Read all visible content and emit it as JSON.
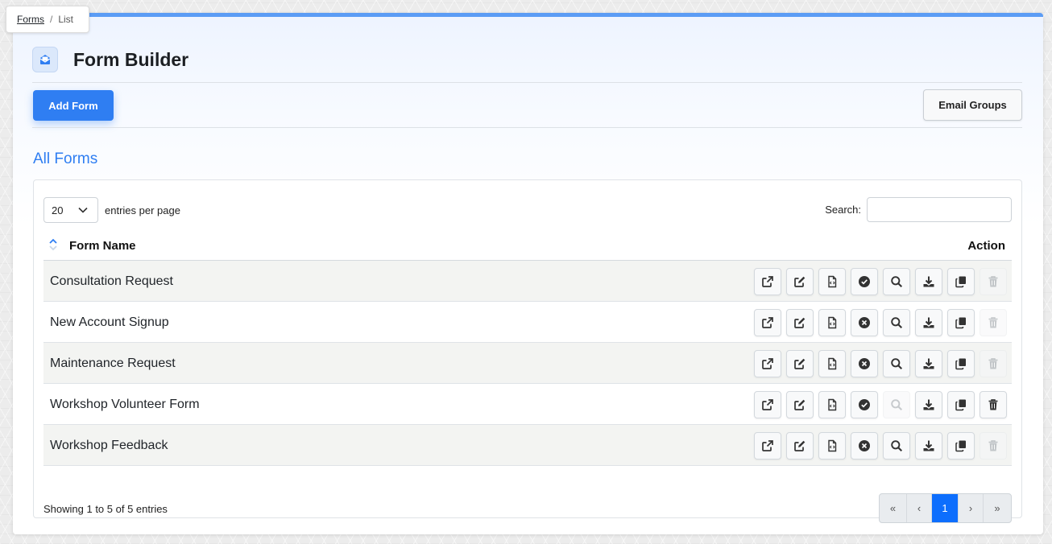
{
  "breadcrumb": {
    "root": "Forms",
    "separator": "/",
    "current": "List"
  },
  "header": {
    "title": "Form Builder",
    "icon": "form-builder-icon"
  },
  "toolbar": {
    "add_label": "Add Form",
    "email_groups_label": "Email Groups"
  },
  "section": {
    "title": "All Forms"
  },
  "table_controls": {
    "per_page_value": "20",
    "per_page_label": "entries per page",
    "search_label": "Search:",
    "search_value": ""
  },
  "table": {
    "columns": {
      "name": "Form Name",
      "action": "Action"
    },
    "rows": [
      {
        "name": "Consultation Request",
        "status": "active",
        "preview_enabled": true,
        "delete_enabled": false
      },
      {
        "name": "New Account Signup",
        "status": "inactive",
        "preview_enabled": true,
        "delete_enabled": false
      },
      {
        "name": "Maintenance Request",
        "status": "inactive",
        "preview_enabled": true,
        "delete_enabled": false
      },
      {
        "name": "Workshop Volunteer Form",
        "status": "active",
        "preview_enabled": false,
        "delete_enabled": true
      },
      {
        "name": "Workshop Feedback",
        "status": "inactive",
        "preview_enabled": true,
        "delete_enabled": false
      }
    ],
    "action_icons": [
      "external-link-icon",
      "edit-icon",
      "code-file-icon",
      "status-toggle-icon",
      "search-icon",
      "download-icon",
      "copy-icon",
      "trash-icon"
    ]
  },
  "footer": {
    "info": "Showing 1 to 5 of 5 entries",
    "pagination": {
      "first": "«",
      "prev": "‹",
      "current": "1",
      "next": "›",
      "last": "»"
    }
  },
  "colors": {
    "accent": "#2f7ef2",
    "top_border": "#5b9cf5",
    "active_page": "#0d6efd"
  }
}
